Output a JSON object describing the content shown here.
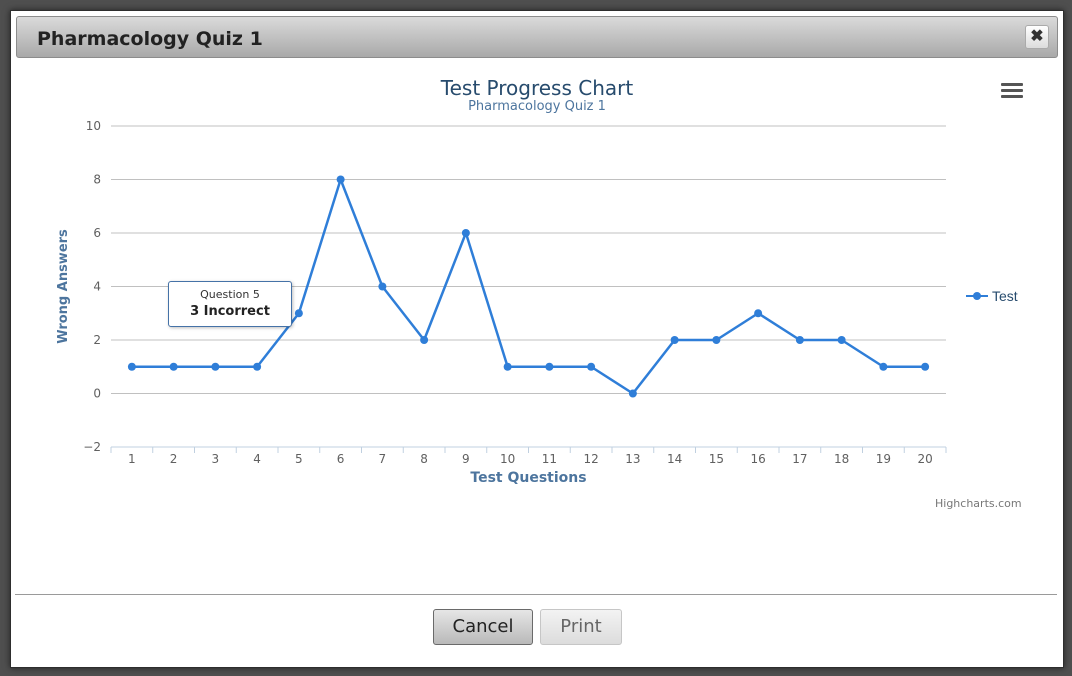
{
  "dialog": {
    "title": "Pharmacology Quiz 1",
    "close_icon": "close-icon",
    "close_glyph": "✖"
  },
  "chart_data": {
    "type": "line",
    "title": "Test Progress Chart",
    "subtitle": "Pharmacology Quiz 1",
    "xlabel": "Test Questions",
    "ylabel": "Wrong Answers",
    "categories": [
      "1",
      "2",
      "3",
      "4",
      "5",
      "6",
      "7",
      "8",
      "9",
      "10",
      "11",
      "12",
      "13",
      "14",
      "15",
      "16",
      "17",
      "18",
      "19",
      "20"
    ],
    "series": [
      {
        "name": "Test",
        "color": "#2f7ed8",
        "values": [
          1,
          1,
          1,
          1,
          3,
          8,
          4,
          2,
          6,
          1,
          1,
          1,
          0,
          2,
          2,
          3,
          2,
          2,
          1,
          1
        ]
      }
    ],
    "yticks": [
      10,
      8,
      6,
      4,
      2,
      0,
      -2
    ],
    "ylim": [
      -2,
      10
    ],
    "grid": true,
    "legend_position": "right"
  },
  "tooltip": {
    "header": "Question 5",
    "body": "3 Incorrect"
  },
  "credit": "Highcharts.com",
  "menu_icon": "hamburger-menu-icon",
  "buttons": {
    "cancel": "Cancel",
    "print": "Print"
  }
}
